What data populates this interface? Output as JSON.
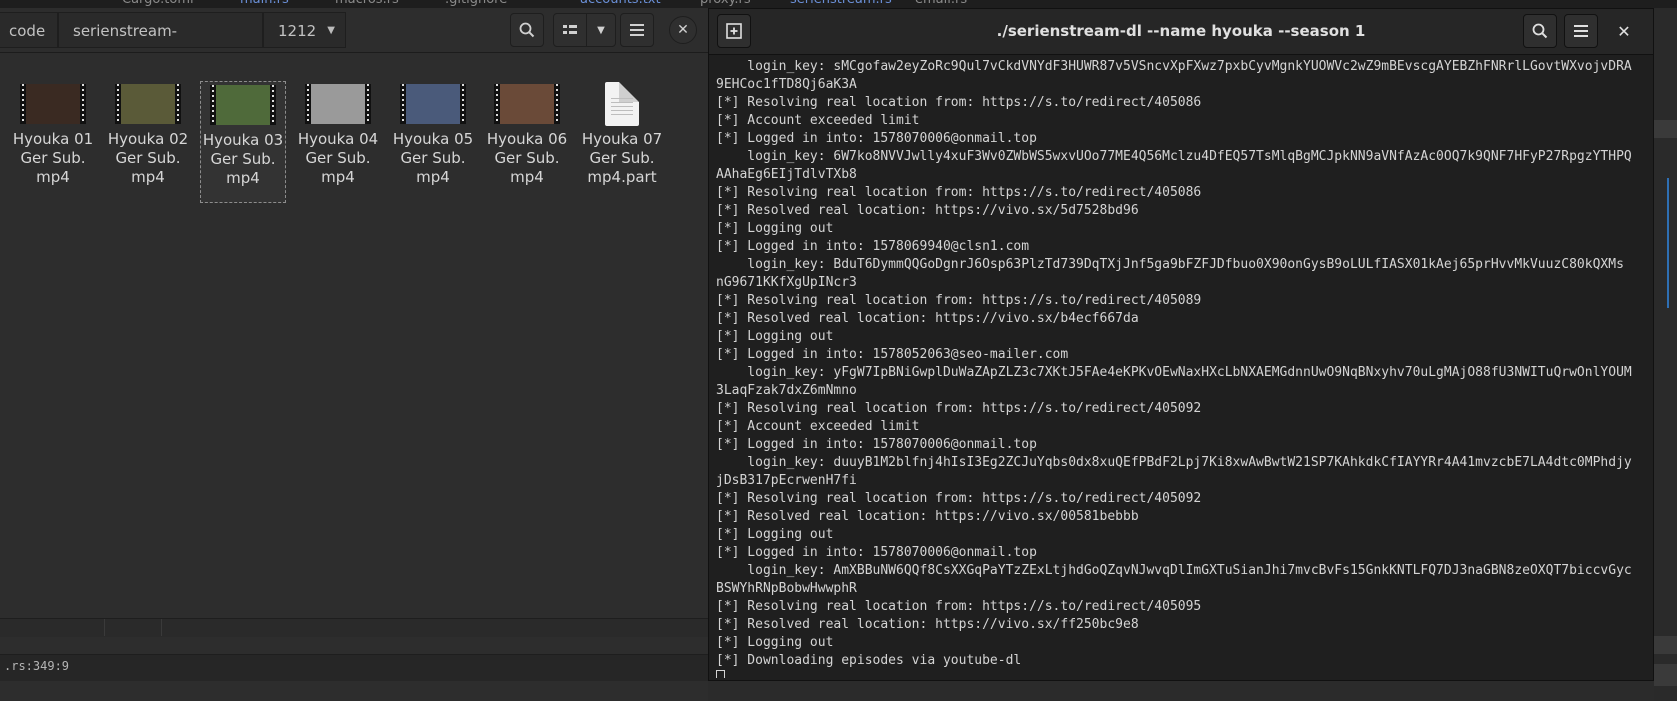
{
  "background_tabs": [
    "Cargo.toml",
    "main.rs",
    "macros.rs",
    ".gitignore",
    "accounts.txt",
    "proxy.rs",
    "serienstream.rs",
    "email.rs"
  ],
  "file_manager": {
    "breadcrumbs": [
      "code",
      "serienstream-downloader",
      "1212"
    ],
    "files": [
      {
        "line1": "Hyouka 01",
        "line2": "Ger Sub.",
        "line3": "mp4",
        "kind": "video",
        "thumb": "#3a2a22",
        "selected": false
      },
      {
        "line1": "Hyouka 02",
        "line2": "Ger Sub.",
        "line3": "mp4",
        "kind": "video",
        "thumb": "#5a5a38",
        "selected": false
      },
      {
        "line1": "Hyouka 03",
        "line2": "Ger Sub.",
        "line3": "mp4",
        "kind": "video",
        "thumb": "#4f6a3a",
        "selected": true
      },
      {
        "line1": "Hyouka 04",
        "line2": "Ger Sub.",
        "line3": "mp4",
        "kind": "video",
        "thumb": "#9a9a9a",
        "selected": false
      },
      {
        "line1": "Hyouka 05",
        "line2": "Ger Sub.",
        "line3": "mp4",
        "kind": "video",
        "thumb": "#4a5a7a",
        "selected": false
      },
      {
        "line1": "Hyouka 06",
        "line2": "Ger Sub.",
        "line3": "mp4",
        "kind": "video",
        "thumb": "#6a4a38",
        "selected": false
      },
      {
        "line1": "Hyouka 07",
        "line2": "Ger Sub.",
        "line3": "mp4.part",
        "kind": "document",
        "thumb": "#f2f2f2",
        "selected": false
      }
    ]
  },
  "editor_status": {
    "position": ".rs:349:9"
  },
  "terminal": {
    "title": "./serienstream-dl --name hyouka --season 1",
    "lines": [
      "    login_key: sMCgofaw2eyZoRc9Qul7vCkdVNYdF3HUWR87v5VSncvXpFXwz7pxbCyvMgnkYUOWVc2wZ9mBEvscgAYEBZhFNRrlLGovtWXvojvDRA",
      "9EHCoc1fTD8Qj6aK3A",
      "[*] Resolving real location from: https://s.to/redirect/405086",
      "[*] Account exceeded limit",
      "[*] Logged in into: 1578070006@onmail.top",
      "    login_key: 6W7ko8NVVJwlly4xuF3Wv0ZWbWS5wxvUOo77ME4Q56Mclzu4DfEQ57TsMlqBgMCJpkNN9aVNfAzAc0OQ7k9QNF7HFyP27RpgzYTHPQ",
      "AAhaEg6EIjTdlvTXb8",
      "[*] Resolving real location from: https://s.to/redirect/405086",
      "[*] Resolved real location: https://vivo.sx/5d7528bd96",
      "[*] Logging out",
      "[*] Logged in into: 1578069940@clsn1.com",
      "    login_key: BduT6DymmQQGoDgnrJ6Osp63PlzTd739DqTXjJnf5ga9bFZFJDfbuo0X90onGysB9oLULfIASX01kAej65prHvvMkVuuzC80kQXMs",
      "nG9671KKfXgUpINcr3",
      "[*] Resolving real location from: https://s.to/redirect/405089",
      "[*] Resolved real location: https://vivo.sx/b4ecf667da",
      "[*] Logging out",
      "[*] Logged in into: 1578052063@seo-mailer.com",
      "    login_key: yFgW7IpBNiGwplDuWaZApZLZ3c7XKtJ5FAe4eKPKvOEwNaxHXcLbNXAEMGdnnUwO9NqBNxyhv70uLgMAjO88fU3NWITuQrwOnlYOUM",
      "3LaqFzak7dxZ6mNmno",
      "[*] Resolving real location from: https://s.to/redirect/405092",
      "[*] Account exceeded limit",
      "[*] Logged in into: 1578070006@onmail.top",
      "    login_key: duuyB1M2blfnj4hIsI3Eg2ZCJuYqbs0dx8xuQEfPBdF2Lpj7Ki8xwAwBwtW21SP7KAhkdkCfIAYYRr4A41mvzcbE7LA4dtc0MPhdjy",
      "jDsB317pEcrwenH7fi",
      "[*] Resolving real location from: https://s.to/redirect/405092",
      "[*] Resolved real location: https://vivo.sx/00581bebbb",
      "[*] Logging out",
      "[*] Logged in into: 1578070006@onmail.top",
      "    login_key: AmXBBuNW6QQf8CsXXGqPaYTzZExLtjhdGoQZqvNJwvqDlImGXTuSianJhi7mvcBvFs15GnkKNTLFQ7DJ3naGBN8zeOXQT7biccvGyc",
      "BSWYhRNpBobwHwwphR",
      "[*] Resolving real location from: https://s.to/redirect/405095",
      "[*] Resolved real location: https://vivo.sx/ff250bc9e8",
      "[*] Logging out",
      "[*] Downloading episodes via youtube-dl"
    ]
  }
}
